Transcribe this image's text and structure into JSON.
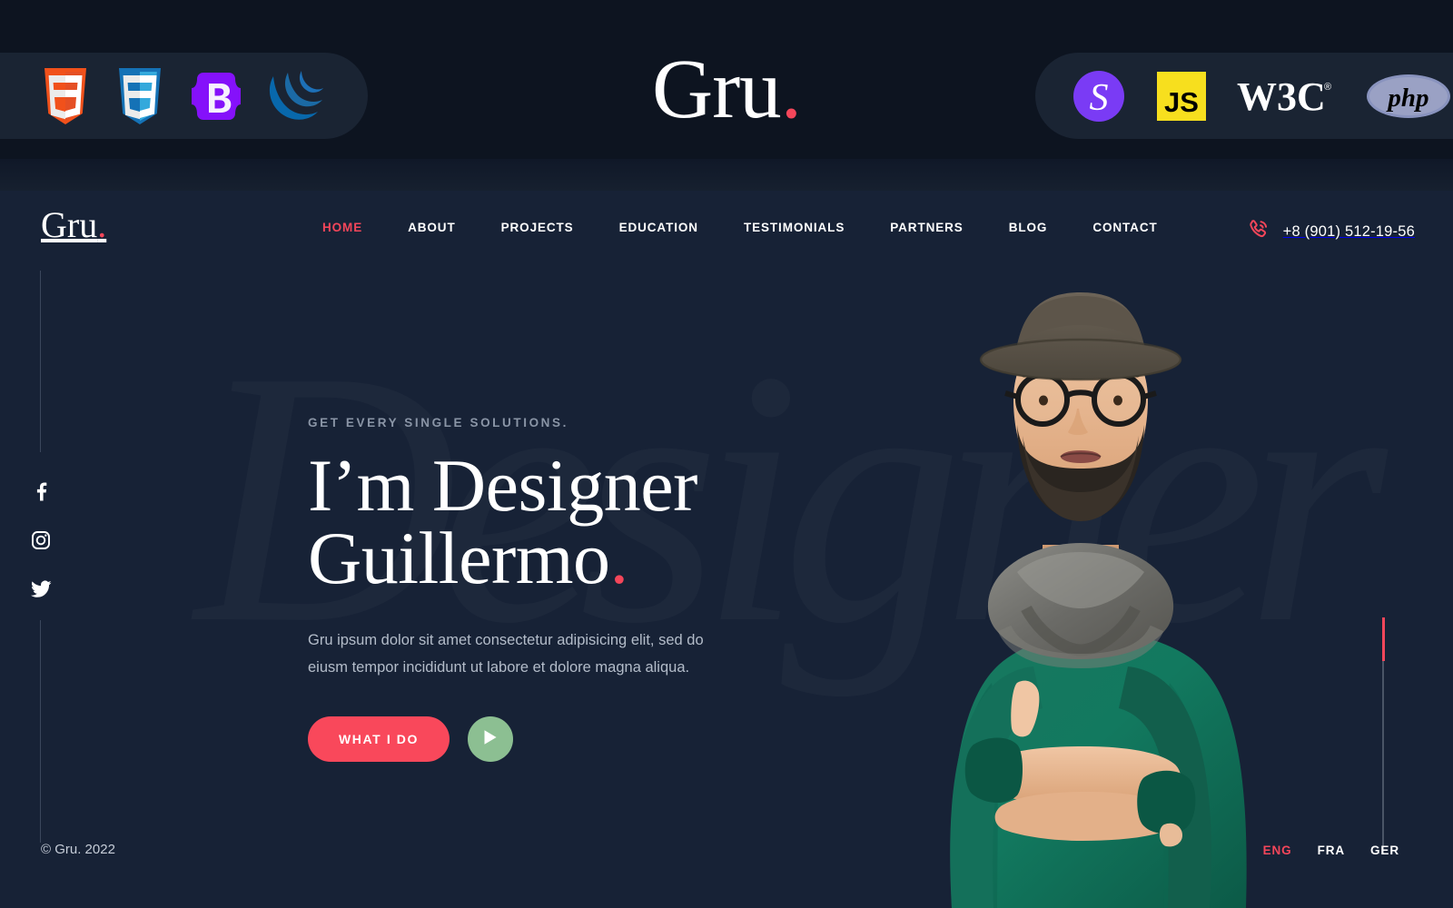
{
  "topbar": {
    "brand": {
      "name": "Gru",
      "dot": "."
    },
    "tech_left": [
      {
        "id": "html5-icon",
        "label": "HTML5"
      },
      {
        "id": "css3-icon",
        "label": "CSS3"
      },
      {
        "id": "bootstrap-icon",
        "label": "Bootstrap"
      },
      {
        "id": "jquery-icon",
        "label": "jQuery"
      }
    ],
    "tech_right": [
      {
        "id": "sass-icon",
        "label": "Sass"
      },
      {
        "id": "javascript-icon",
        "label": "JavaScript"
      },
      {
        "id": "w3c-icon",
        "label": "W3C"
      },
      {
        "id": "php-icon",
        "label": "PHP"
      }
    ]
  },
  "nav": {
    "logo": {
      "name": "Gru",
      "dot": "."
    },
    "items": [
      {
        "label": "HOME",
        "active": true
      },
      {
        "label": "ABOUT",
        "active": false
      },
      {
        "label": "PROJECTS",
        "active": false
      },
      {
        "label": "EDUCATION",
        "active": false
      },
      {
        "label": "TESTIMONIALS",
        "active": false
      },
      {
        "label": "PARTNERS",
        "active": false
      },
      {
        "label": "BLOG",
        "active": false
      },
      {
        "label": "CONTACT",
        "active": false
      }
    ],
    "phone": "+8 (901) 512-19-56",
    "phone_icon": "phone-call-icon"
  },
  "hero": {
    "watermark": "Designer",
    "eyebrow": "GET EVERY SINGLE SOLUTIONS.",
    "title_line1": "I’m Designer",
    "title_line2": "Guillermo",
    "title_dot": ".",
    "paragraph": "Gru ipsum dolor sit amet consectetur adipisicing elit, sed do eiusm tempor incididunt ut labore et dolore magna aliqua.",
    "cta_primary": "WHAT I DO",
    "cta_play_icon": "play-icon",
    "social": [
      {
        "id": "facebook-icon",
        "label": "Facebook"
      },
      {
        "id": "instagram-icon",
        "label": "Instagram"
      },
      {
        "id": "twitter-icon",
        "label": "Twitter"
      }
    ]
  },
  "footer": {
    "copyright": "© Gru. 2022",
    "languages": [
      {
        "label": "ENG",
        "active": true
      },
      {
        "label": "FRA",
        "active": false
      },
      {
        "label": "GER",
        "active": false
      }
    ]
  },
  "colors": {
    "accent_red": "#f4465a",
    "cta_red": "#f9485b",
    "play_green": "#8cbf92",
    "background": "#172236",
    "topbar_background": "#0d1420",
    "pill_background": "#1a2433"
  }
}
